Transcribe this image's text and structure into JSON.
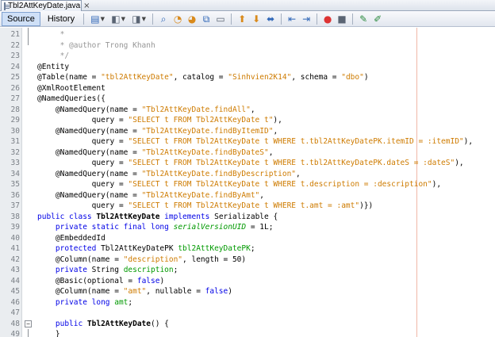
{
  "tab": {
    "filename": "Tbl2AttKeyDate.java",
    "close": "×"
  },
  "toolbar": {
    "source_label": "Source",
    "history_label": "History",
    "icons": [
      "last-edit-icon",
      "back-icon",
      "forward-icon",
      "find-previous-icon",
      "find-icon",
      "find-next-icon",
      "find-selection-icon",
      "toggle-highlight-icon",
      "shift-left-icon",
      "shift-right-icon",
      "toggle-comment-icon",
      "uncomment-icon",
      "record-macro-icon",
      "stop-macro-icon",
      "previous-bookmark-icon",
      "next-bookmark-icon"
    ]
  },
  "editor": {
    "lines": [
      {
        "n": "21",
        "tokens": [
          {
            "t": "     *",
            "c": "cm"
          }
        ]
      },
      {
        "n": "22",
        "tokens": [
          {
            "t": "     * @author Trong Khanh",
            "c": "cm"
          }
        ]
      },
      {
        "n": "23",
        "tokens": [
          {
            "t": "     */",
            "c": "cm"
          }
        ]
      },
      {
        "n": "24",
        "tokens": [
          {
            "t": "@Entity",
            "c": "ann"
          }
        ]
      },
      {
        "n": "25",
        "tokens": [
          {
            "t": "@Table(name = ",
            "c": "ann"
          },
          {
            "t": "\"tbl2AttKeyDate\"",
            "c": "str"
          },
          {
            "t": ", catalog = ",
            "c": ""
          },
          {
            "t": "\"Sinhvien2K14\"",
            "c": "str"
          },
          {
            "t": ", schema = ",
            "c": ""
          },
          {
            "t": "\"dbo\"",
            "c": "str"
          },
          {
            "t": ")",
            "c": ""
          }
        ]
      },
      {
        "n": "26",
        "tokens": [
          {
            "t": "@XmlRootElement",
            "c": "ann"
          }
        ]
      },
      {
        "n": "27",
        "tokens": [
          {
            "t": "@NamedQueries({",
            "c": "ann"
          }
        ]
      },
      {
        "n": "28",
        "tokens": [
          {
            "t": "    @NamedQuery(name = ",
            "c": "ann"
          },
          {
            "t": "\"Tbl2AttKeyDate.findAll\"",
            "c": "str"
          },
          {
            "t": ",",
            "c": ""
          }
        ]
      },
      {
        "n": "29",
        "tokens": [
          {
            "t": "            query = ",
            "c": ""
          },
          {
            "t": "\"SELECT t FROM Tbl2AttKeyDate t\"",
            "c": "str"
          },
          {
            "t": "),",
            "c": ""
          }
        ]
      },
      {
        "n": "30",
        "tokens": [
          {
            "t": "    @NamedQuery(name = ",
            "c": "ann"
          },
          {
            "t": "\"Tbl2AttKeyDate.findByItemID\"",
            "c": "str"
          },
          {
            "t": ",",
            "c": ""
          }
        ]
      },
      {
        "n": "31",
        "tokens": [
          {
            "t": "            query = ",
            "c": ""
          },
          {
            "t": "\"SELECT t FROM Tbl2AttKeyDate t WHERE t.tbl2AttKeyDatePK.itemID = :itemID\"",
            "c": "str"
          },
          {
            "t": "),",
            "c": ""
          }
        ]
      },
      {
        "n": "32",
        "tokens": [
          {
            "t": "    @NamedQuery(name = ",
            "c": "ann"
          },
          {
            "t": "\"Tbl2AttKeyDate.findByDateS\"",
            "c": "str"
          },
          {
            "t": ",",
            "c": ""
          }
        ]
      },
      {
        "n": "33",
        "tokens": [
          {
            "t": "            query = ",
            "c": ""
          },
          {
            "t": "\"SELECT t FROM Tbl2AttKeyDate t WHERE t.tbl2AttKeyDatePK.dateS = :dateS\"",
            "c": "str"
          },
          {
            "t": "),",
            "c": ""
          }
        ]
      },
      {
        "n": "34",
        "tokens": [
          {
            "t": "    @NamedQuery(name = ",
            "c": "ann"
          },
          {
            "t": "\"Tbl2AttKeyDate.findByDescription\"",
            "c": "str"
          },
          {
            "t": ",",
            "c": ""
          }
        ]
      },
      {
        "n": "35",
        "tokens": [
          {
            "t": "            query = ",
            "c": ""
          },
          {
            "t": "\"SELECT t FROM Tbl2AttKeyDate t WHERE t.description = :description\"",
            "c": "str"
          },
          {
            "t": "),",
            "c": ""
          }
        ]
      },
      {
        "n": "36",
        "tokens": [
          {
            "t": "    @NamedQuery(name = ",
            "c": "ann"
          },
          {
            "t": "\"Tbl2AttKeyDate.findByAmt\"",
            "c": "str"
          },
          {
            "t": ",",
            "c": ""
          }
        ]
      },
      {
        "n": "37",
        "tokens": [
          {
            "t": "            query = ",
            "c": ""
          },
          {
            "t": "\"SELECT t FROM Tbl2AttKeyDate t WHERE t.amt = :amt\"",
            "c": "str"
          },
          {
            "t": ")})",
            "c": ""
          }
        ]
      },
      {
        "n": "38",
        "tokens": [
          {
            "t": "public class ",
            "c": "kw"
          },
          {
            "t": "Tbl2AttKeyDate",
            "c": "cls"
          },
          {
            "t": " ",
            "c": ""
          },
          {
            "t": "implements",
            "c": "kw"
          },
          {
            "t": " Serializable {",
            "c": ""
          }
        ]
      },
      {
        "n": "39",
        "tokens": [
          {
            "t": "    private static final long ",
            "c": "kw"
          },
          {
            "t": "serialVersionUID",
            "c": "sfld"
          },
          {
            "t": " = 1L;",
            "c": ""
          }
        ]
      },
      {
        "n": "40",
        "tokens": [
          {
            "t": "    @EmbeddedId",
            "c": "ann"
          }
        ]
      },
      {
        "n": "41",
        "tokens": [
          {
            "t": "    protected ",
            "c": "kw"
          },
          {
            "t": "Tbl2AttKeyDatePK ",
            "c": ""
          },
          {
            "t": "tbl2AttKeyDatePK",
            "c": "fld"
          },
          {
            "t": ";",
            "c": ""
          }
        ]
      },
      {
        "n": "42",
        "tokens": [
          {
            "t": "    @Column(name = ",
            "c": "ann"
          },
          {
            "t": "\"description\"",
            "c": "str"
          },
          {
            "t": ", length = 50)",
            "c": ""
          }
        ]
      },
      {
        "n": "43",
        "tokens": [
          {
            "t": "    private ",
            "c": "kw"
          },
          {
            "t": "String ",
            "c": ""
          },
          {
            "t": "description",
            "c": "fld"
          },
          {
            "t": ";",
            "c": ""
          }
        ]
      },
      {
        "n": "44",
        "tokens": [
          {
            "t": "    @Basic(optional = ",
            "c": "ann"
          },
          {
            "t": "false",
            "c": "kw"
          },
          {
            "t": ")",
            "c": ""
          }
        ]
      },
      {
        "n": "45",
        "tokens": [
          {
            "t": "    @Column(name = ",
            "c": "ann"
          },
          {
            "t": "\"amt\"",
            "c": "str"
          },
          {
            "t": ", nullable = ",
            "c": ""
          },
          {
            "t": "false",
            "c": "kw"
          },
          {
            "t": ")",
            "c": ""
          }
        ]
      },
      {
        "n": "46",
        "tokens": [
          {
            "t": "    private long ",
            "c": "kw"
          },
          {
            "t": "amt",
            "c": "fld"
          },
          {
            "t": ";",
            "c": ""
          }
        ]
      },
      {
        "n": "47",
        "tokens": [
          {
            "t": "",
            "c": ""
          }
        ]
      },
      {
        "n": "48",
        "tokens": [
          {
            "t": "    public ",
            "c": "kw"
          },
          {
            "t": "Tbl2AttKeyDate",
            "c": "cls"
          },
          {
            "t": "() {",
            "c": ""
          }
        ]
      },
      {
        "n": "49",
        "tokens": [
          {
            "t": "    }",
            "c": ""
          }
        ]
      }
    ]
  }
}
